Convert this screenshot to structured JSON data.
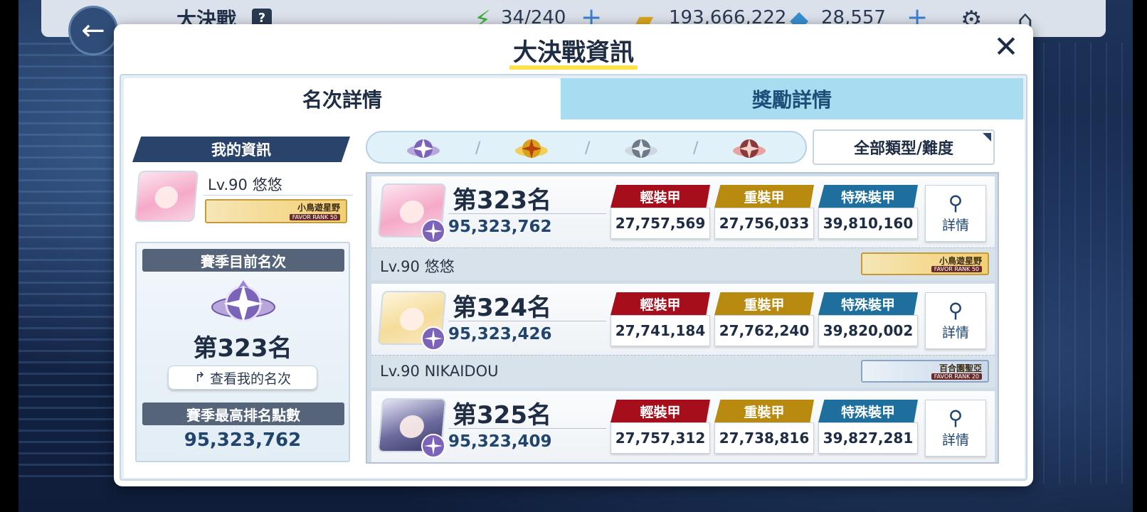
{
  "topbar": {
    "title": "大決戰",
    "help": "?",
    "stamina": "34/240",
    "credits": "193,666,222",
    "gems": "28,557"
  },
  "dialog": {
    "title": "大決戰資訊",
    "close": "✕",
    "tabs": [
      {
        "label": "名次詳情",
        "active": true
      },
      {
        "label": "獎勵詳情",
        "active": false
      }
    ]
  },
  "my_info": {
    "header": "我的資訊",
    "name": "Lv.90  悠悠",
    "favor_name": "小鳥遊星野",
    "favor_rank": "FAVOR RANK 50"
  },
  "season": {
    "current_header": "賽季目前名次",
    "current_rank": "第323名",
    "view_button": "查看我的名次",
    "best_header": "賽季最高排名點數",
    "best_points": "95,323,762"
  },
  "filter": {
    "dropdown_label": "全部類型/難度",
    "emblems": [
      "purple",
      "gold",
      "silver",
      "bronze"
    ]
  },
  "armor_labels": {
    "light": "輕裝甲",
    "heavy": "重裝甲",
    "special": "特殊裝甲"
  },
  "detail_label": "詳情",
  "rankings": [
    {
      "rank": "第323名",
      "score": "95,323,762",
      "light": "27,757,569",
      "heavy": "27,756,033",
      "special": "39,810,160",
      "name": "Lv.90  悠悠",
      "favor_name": "小鳥遊星野",
      "favor_rank": "FAVOR RANK 50",
      "avatar": "pink"
    },
    {
      "rank": "第324名",
      "score": "95,323,426",
      "light": "27,741,184",
      "heavy": "27,762,240",
      "special": "39,820,002",
      "name": "Lv.90  NIKAIDOU",
      "favor_name": "百合園聖亞",
      "favor_rank": "FAVOR RANK 20",
      "avatar": "blonde"
    },
    {
      "rank": "第325名",
      "score": "95,323,409",
      "light": "27,757,312",
      "heavy": "27,738,816",
      "special": "39,827,281",
      "name": "",
      "favor_name": "",
      "favor_rank": "",
      "avatar": "purple"
    }
  ],
  "colors": {
    "light_armor": "#a50e1a",
    "heavy_armor": "#b98a10",
    "special_armor": "#1e6f9e",
    "accent_underline": "#ffe14a"
  }
}
